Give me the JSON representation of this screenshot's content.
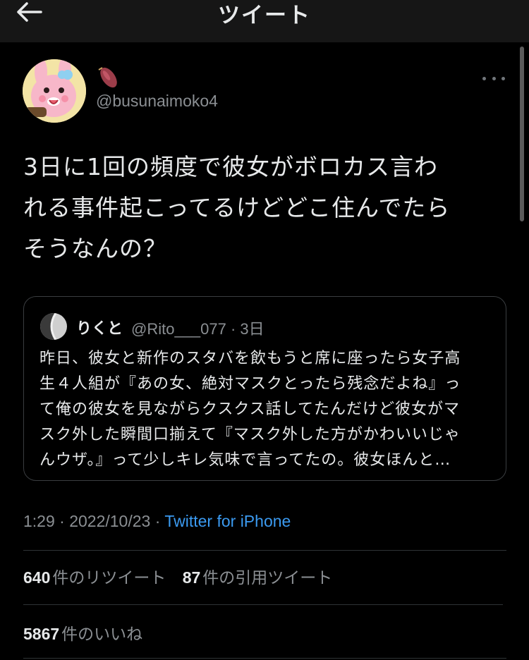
{
  "header": {
    "title": "ツイート",
    "back_icon": "arrow-left-icon"
  },
  "tweet": {
    "author_handle": "@busunaimoko4",
    "author_name_icon": "sweet-potato-emoji",
    "text_lines": [
      "3日に1回の頻度で彼女がボロカス言わ",
      "れる事件起こってるけどどこ住んでたら",
      "そうなんの？"
    ],
    "timestamp": "1:29 · 2022/10/23 · ",
    "source": "Twitter for iPhone"
  },
  "quote": {
    "name": "りくと",
    "handle_time": "@Rito___077 · 3日",
    "text_lines": [
      "昨日、彼女と新作のスタバを飲もうと席に座ったら女子高",
      "生４人組が『あの女、絶対マスクとったら残念だよね』っ",
      "て俺の彼女を見ながらクスクス話してたんだけど彼女がマ",
      "スク外した瞬間口揃えて『マスク外した方がかわいいじゃ",
      "んウザ。』って少しキレ気味で言ってたの。彼女ほんと…"
    ]
  },
  "stats": {
    "retweets": "640",
    "retweets_label": "件のリツイート",
    "quotes": "87",
    "quotes_label": "件の引用ツイート",
    "likes": "5867",
    "likes_label": "件のいいね"
  },
  "colors": {
    "link": "#3b9af0",
    "muted": "#8b8f93",
    "text": "#e7e9ea",
    "background": "#000000",
    "header": "#161616"
  }
}
